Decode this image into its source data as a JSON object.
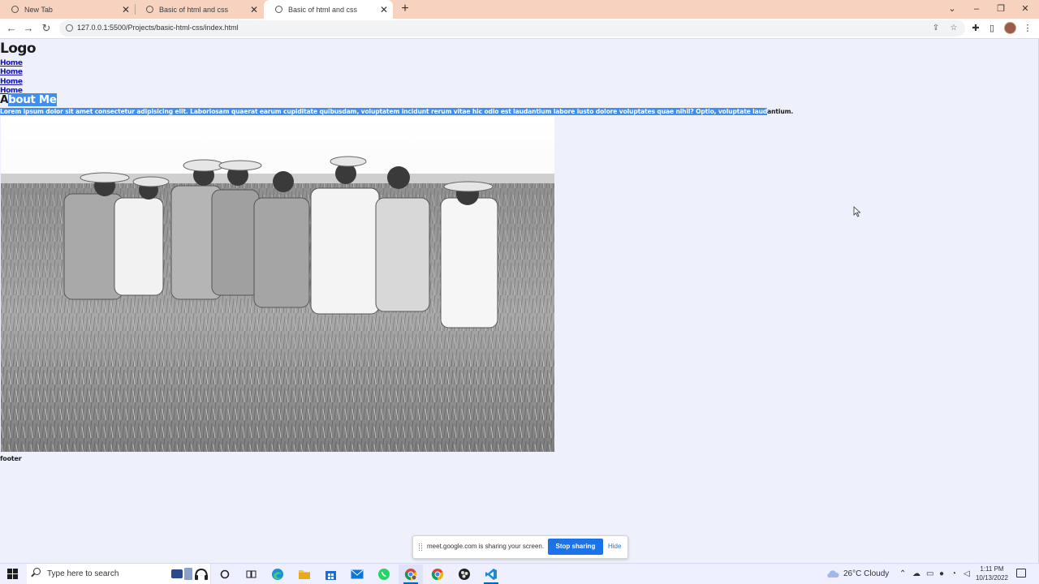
{
  "browser": {
    "tabs": [
      {
        "title": "New Tab",
        "active": false
      },
      {
        "title": "Basic of html and css",
        "active": false
      },
      {
        "title": "Basic of html and css",
        "active": true
      }
    ],
    "url": "127.0.0.1:5500/Projects/basic-html-css/index.html"
  },
  "page": {
    "logo": "Logo",
    "nav": [
      "Home",
      "Home",
      "Home",
      "Home"
    ],
    "about_first": "A",
    "about_rest": "bout Me",
    "paragraph_selected": "Lorem ipsum dolor sit amet consectetur adipisicing elit. Laboriosam quaerat earum cupiditate quibusdam, voluptatem incidunt rerum vitae hic odio est laudantium labore iusto dolore voluptates quae nihil? Optio, voluptate laud",
    "paragraph_rest": "antium.",
    "footer": "footer"
  },
  "sharing": {
    "message": "meet.google.com is sharing your screen.",
    "stop_label": "Stop sharing",
    "hide_label": "Hide"
  },
  "taskbar": {
    "search_placeholder": "Type here to search",
    "weather": "26°C  Cloudy",
    "time": "1:11 PM",
    "date": "10/13/2022",
    "apps": [
      "task-view-icon",
      "cortana-icon",
      "edge-icon",
      "file-explorer-icon",
      "store-icon",
      "mail-icon",
      "whatsapp-icon",
      "chrome-profile-icon",
      "chrome-icon",
      "obs-icon",
      "vscode-icon"
    ]
  },
  "colors": {
    "tab_strip": "#f6d2bf",
    "page_background": "#eef0fb",
    "selection": "#3f8ff0",
    "link": "#1414b4",
    "accent": "#1a73e8"
  }
}
